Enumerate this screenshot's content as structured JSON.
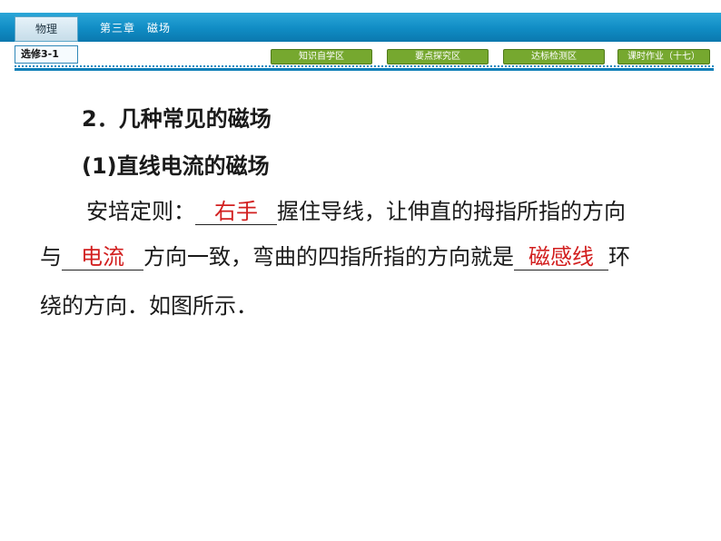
{
  "header": {
    "subject": "物理",
    "chapter": "第三章　磁场",
    "module": "选修3-1",
    "nav": [
      {
        "label": "知识自学区"
      },
      {
        "label": "要点探究区"
      },
      {
        "label": "达标检测区"
      },
      {
        "label": "课时作业（十七）"
      }
    ]
  },
  "content": {
    "section_title": "2．几种常见的磁场",
    "subsection_title": "(1)直线电流的磁场",
    "para1_prefix": "安培定则：",
    "blank1": "右手",
    "para1_suffix": "握住导线，让伸直的拇指所指的方向",
    "para2_prefix": "与",
    "blank2": "电流",
    "para2_middle": "方向一致，弯曲的四指所指的方向就是",
    "blank3": "磁感线",
    "para2_suffix": "环",
    "para3": "绕的方向．如图所示．"
  },
  "colors": {
    "header_bar": "#108cc4",
    "nav_button": "#76a82f",
    "answer_red": "#d21f1f"
  }
}
